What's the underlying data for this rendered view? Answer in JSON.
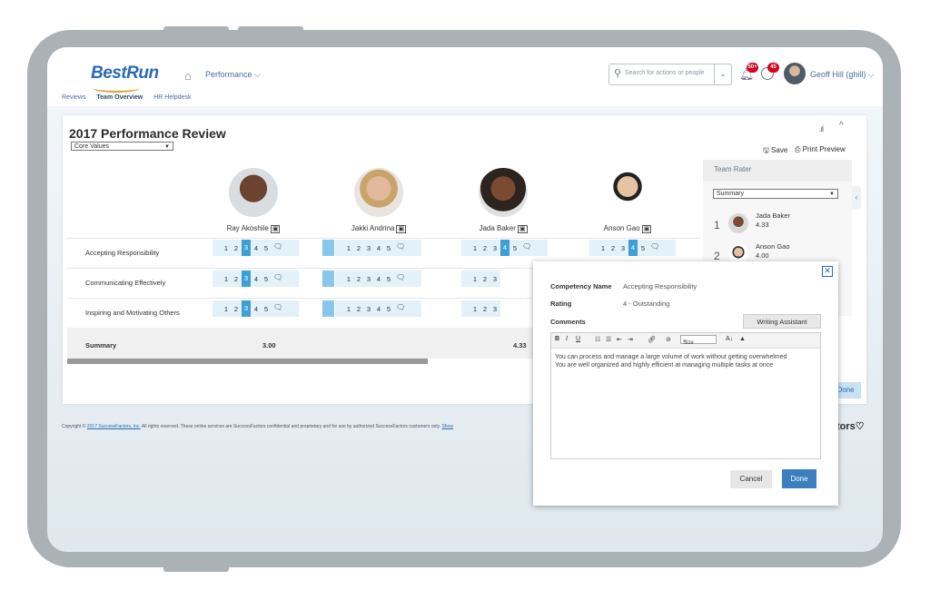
{
  "header": {
    "logo": "BestRun",
    "nav_menu": "Performance ⌵",
    "search_placeholder": "Search for actions or people",
    "notif_badge": "50+",
    "todo_badge": "45",
    "user_name": "Geoff Hill (ghill) ⌵"
  },
  "tabs": [
    "Reviews",
    "Team Overview",
    "HR Helpdesk"
  ],
  "page": {
    "title": "2017 Performance Review",
    "filter": "Core Values",
    "save": "Save",
    "print": "Print Preview"
  },
  "employees": [
    {
      "name": "Ray Akoshile"
    },
    {
      "name": "Jakki Andrina"
    },
    {
      "name": "Jada Baker"
    },
    {
      "name": "Anson Gao"
    }
  ],
  "competencies": [
    "Accepting Responsibility",
    "Communicating Effectively",
    "Inspiring and Motivating Others"
  ],
  "scale": [
    "1",
    "2",
    "3",
    "4",
    "5"
  ],
  "summary": {
    "label": "Summary",
    "values": [
      "3.00",
      "4.33"
    ]
  },
  "team_rater": {
    "title": "Team Rater",
    "select": "Summary",
    "items": [
      {
        "rank": "1",
        "name": "Jada Baker",
        "score": "4.33"
      },
      {
        "rank": "2",
        "name": "Anson Gao",
        "score": "4.00"
      }
    ]
  },
  "behind_done": "Done",
  "footer": {
    "pre": "Copyright © ",
    "link": "2017 SuccessFactors, Inc.",
    "text": " All rights reserved. These online services are SuccessFactors confidential and proprietary and for use by authorized SuccessFactors customers only.",
    "link2": "Show",
    "brand": "tors"
  },
  "popup": {
    "competency_label": "Competency Name",
    "competency_value": "Accepting Responsibility",
    "rating_label": "Rating",
    "rating_value": "4 - Outstanding",
    "comments_label": "Comments",
    "writing_assistant": "Writing Assistant",
    "size_label": "Size",
    "comment_lines": [
      "You can process and manage a large volume of work without getting overwhelmed",
      "You are well organized and highly efficient at managing multiple tasks at once"
    ],
    "cancel": "Cancel",
    "done": "Done"
  }
}
